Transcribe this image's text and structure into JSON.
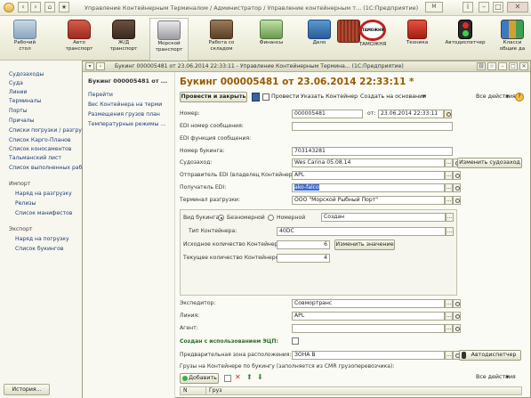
{
  "outer_window": {
    "title": "Управление Контейнерным Терминалом / Администратор / Управление контейнерным т... (1С:Предприятие)"
  },
  "toolbar": {
    "items": [
      {
        "label": "Рабочий\nстол",
        "icon": "desk-icon"
      },
      {
        "label": "Авто\nтранспорт",
        "icon": "truck-icon"
      },
      {
        "label": "Ж/Д\nтранспорт",
        "icon": "train-icon"
      },
      {
        "label": "Морской\nтранспорт",
        "icon": "ship-icon"
      },
      {
        "label": "Работа со\nскладом",
        "icon": "warehouse-icon"
      },
      {
        "label": "Финансы",
        "icon": "money-icon"
      },
      {
        "label": "Дело",
        "icon": "folder-icon"
      },
      {
        "label": "",
        "icon": "container-icon"
      },
      {
        "label": "ТАМОЖНЯ",
        "icon": "customs-icon"
      },
      {
        "label": "Техника",
        "icon": "crane-icon"
      },
      {
        "label": "Автодиспетчер",
        "icon": "traffic-light-icon"
      },
      {
        "label": "Класси\nобщие да",
        "icon": "books-icon"
      }
    ],
    "customs_sign_text": "ТАМОЖНЯ"
  },
  "left_panel": {
    "items": [
      "Судозаходы",
      "Суда",
      "Линии",
      "Терминалы",
      "Порты",
      "Причалы",
      "Списки погрузки / разгрузк",
      "Список Карго-Планов",
      "Список коносаментов",
      "Тальманский лист",
      "Список выполненных рабо"
    ],
    "import_header": "Импорт",
    "import_items": [
      "Наряд на разгрузку",
      "Релизы",
      "Список манифестов"
    ],
    "export_header": "Экспорт",
    "export_items": [
      "Наряд на погрузку",
      "Список букингов"
    ],
    "history_button": "История..."
  },
  "doc_window": {
    "title": "Букинг 000005481 от 23.06.2014 22:33:11 - Управление Контейнерным Термина... (1С:Предприятие)",
    "nav_header": "Букинг 000005481 от ...",
    "nav_group": "Перейти",
    "nav_links": [
      "Вес Контейнера на терми",
      "Размещения грузов план",
      "Температурные режимы ..."
    ],
    "heading": "Букинг 000005481 от 23.06.2014 22:33:11 *",
    "actions": {
      "post_close": "Провести и закрыть",
      "post": "Провести",
      "specify_container": "Указать Контейнер",
      "create_based": "Создать на основании",
      "all_actions": "Все действия"
    },
    "fields": {
      "number_label": "Номер:",
      "number_value": "000005481",
      "date_label": "от:",
      "date_value": "23.06.2014 22:33:11",
      "edi_number_label": "EDI номер сообщения:",
      "edi_number_value": "",
      "edi_function_label": "EDI функция сообщения:",
      "booking_number_label": "Номер букинга:",
      "booking_number_value": "703143281",
      "voyage_label": "Судозаход:",
      "voyage_value": "Wes Carina 05.08.14",
      "change_voyage_button": "Изменить судозаход",
      "sender_label": "Отправитель EDI (владелец Контейнера):",
      "sender_value": "APL",
      "receiver_label": "Получатель EDI:",
      "receiver_value": "ako-falco",
      "terminal_label": "Терминал разгрузки:",
      "terminal_value": "ООО \"Морской Рыбный Порт\"",
      "booking_type_label": "Вид букинга:",
      "type_nonnumbered": "Безномерной",
      "type_numbered": "Номерной",
      "status_value": "Создан",
      "container_type_label": "Тип Контейнера:",
      "container_type_value": "40DC",
      "initial_count_label": "Исходное количество Контейнеров:",
      "initial_count_value": "6",
      "change_value_button": "Изменить значение",
      "current_count_label": "Текущее количество Контейнеров:",
      "current_count_value": "4",
      "forwarder_label": "Экспедитор:",
      "forwarder_value": "Совмортранс",
      "line_label": "Линия:",
      "line_value": "APL",
      "agent_label": "Агент:",
      "agent_value": "",
      "ecp_label": "Создан с использованием ЭЦП:",
      "zone_label": "Предварительная зона расположения:",
      "zone_value": "ЗОНА B",
      "dispatcher_button": "Автодиспетчер",
      "cargo_label": "Грузы на Контейнере по букингу (заполняется из CMR грузоперевозчика):",
      "add_button": "Добавить",
      "all_actions2": "Все действия",
      "col_n": "N",
      "col_cargo": "Груз"
    }
  }
}
